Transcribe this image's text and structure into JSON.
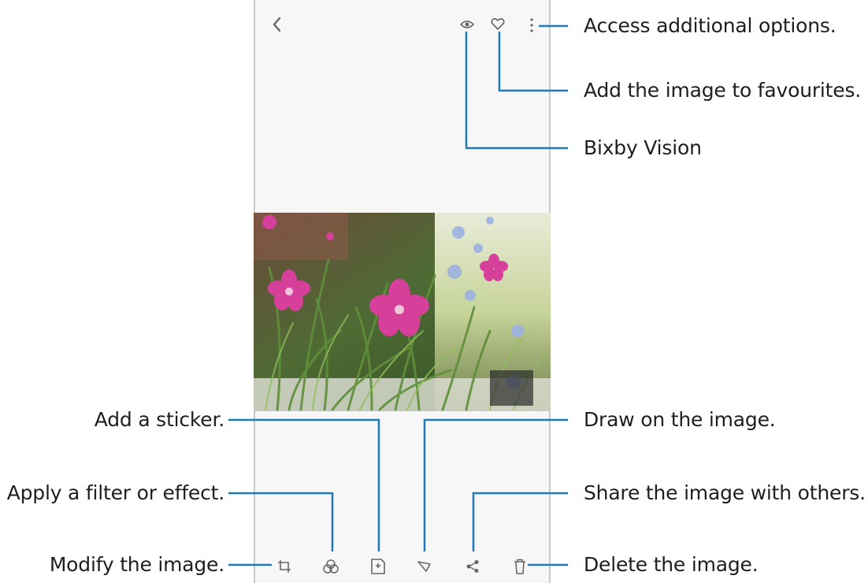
{
  "header_icons": {
    "back": "back-chevron-icon",
    "bixby_vision": "eye-icon",
    "favourite": "heart-icon",
    "more_options": "more-options-icon"
  },
  "toolbar_icons": [
    "edit-icon",
    "filter-icon",
    "sticker-icon",
    "draw-icon",
    "share-icon",
    "delete-icon"
  ],
  "callouts": {
    "more_options": "Access additional options.",
    "favourite": "Add the image to favourites.",
    "bixby_vision": "Bixby Vision",
    "sticker": "Add a sticker.",
    "draw": "Draw on the image.",
    "filter": "Apply a filter or effect.",
    "share": "Share the image with others.",
    "modify": "Modify the image.",
    "delete": "Delete the image."
  },
  "colors": {
    "leader_line": "#1f7ab5",
    "flower_pink": "#d6409a",
    "foliage_green": "#3f6b2a"
  }
}
